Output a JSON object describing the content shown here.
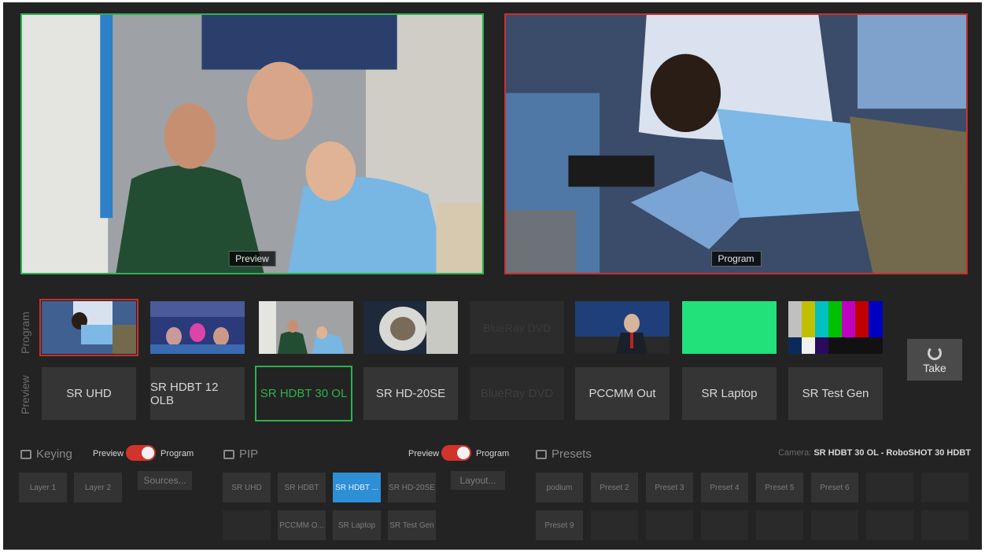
{
  "monitors": {
    "preview_label": "Preview",
    "program_label": "Program"
  },
  "buses": {
    "program_label": "Program",
    "preview_label": "Preview"
  },
  "program_sources": [
    {
      "name": "SR UHD",
      "state": "active"
    },
    {
      "name": "SR HDBT 12 OLB",
      "state": "normal"
    },
    {
      "name": "SR HDBT 30 OL",
      "state": "normal"
    },
    {
      "name": "SR HD-20SE",
      "state": "normal"
    },
    {
      "name": "BlueRay DVD",
      "state": "empty"
    },
    {
      "name": "PCCMM Out",
      "state": "normal"
    },
    {
      "name": "SR Laptop",
      "state": "normal"
    },
    {
      "name": "SR Test Gen",
      "state": "normal"
    }
  ],
  "preview_sources": [
    {
      "label": "SR UHD",
      "state": "normal"
    },
    {
      "label": "SR HDBT 12 OLB",
      "state": "normal"
    },
    {
      "label": "SR HDBT 30 OL",
      "state": "active"
    },
    {
      "label": "SR HD-20SE",
      "state": "normal"
    },
    {
      "label": "BlueRay DVD",
      "state": "disabled"
    },
    {
      "label": "PCCMM Out",
      "state": "normal"
    },
    {
      "label": "SR Laptop",
      "state": "normal"
    },
    {
      "label": "SR Test Gen",
      "state": "normal"
    }
  ],
  "take_label": "Take",
  "keying": {
    "title": "Keying",
    "toggle_left": "Preview",
    "toggle_right": "Program",
    "layers": [
      "Layer 1",
      "Layer 2"
    ],
    "sources_button": "Sources..."
  },
  "pip": {
    "title": "PIP",
    "toggle_left": "Preview",
    "toggle_right": "Program",
    "row1": [
      "SR UHD",
      "SR HDBT",
      "SR HDBT ...",
      "SR HD-20SE"
    ],
    "row2": [
      "",
      "PCCMM O...",
      "SR Laptop",
      "SR Test Gen"
    ],
    "selected": "SR HDBT ...",
    "layout_button": "Layout..."
  },
  "presets": {
    "title": "Presets",
    "camera_prefix": "Camera:",
    "camera_value": "SR HDBT 30 OL - RoboSHOT 30 HDBT",
    "row1": [
      "podium",
      "Preset 2",
      "Preset 3",
      "Preset 4",
      "Preset 5",
      "Preset 6",
      "",
      ""
    ],
    "row2": [
      "Preset 9",
      "",
      "",
      "",
      "",
      "",
      "",
      ""
    ]
  },
  "colors": {
    "preview_accent": "#2bb34f",
    "program_accent": "#c9302c",
    "selected_blue": "#2d8fd5"
  }
}
